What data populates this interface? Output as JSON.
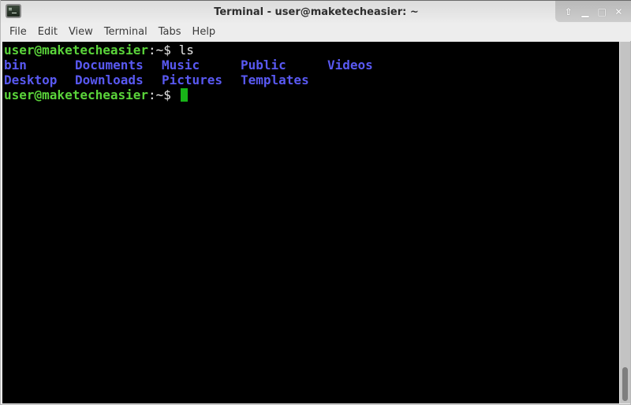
{
  "window": {
    "title": "Terminal - user@maketecheasier: ~",
    "app_icon": "terminal-icon",
    "controls": [
      {
        "name": "keep-above",
        "glyph": "⇧"
      },
      {
        "name": "minimize",
        "glyph": "▁"
      },
      {
        "name": "maximize",
        "glyph": "□"
      },
      {
        "name": "close",
        "glyph": "✕"
      }
    ]
  },
  "menubar": {
    "items": [
      "File",
      "Edit",
      "View",
      "Terminal",
      "Tabs",
      "Help"
    ]
  },
  "terminal": {
    "prompt_user": "user@maketecheasier",
    "prompt_suffix": ":~$ ",
    "command": "ls",
    "listing_row1": [
      "bin",
      "Documents",
      "Music",
      "Public",
      "Videos"
    ],
    "listing_row2": [
      "Desktop",
      "Downloads",
      "Pictures",
      "Templates"
    ],
    "colors": {
      "prompt": "#5ad33a",
      "directory": "#5959f2",
      "text": "#e8e8e8",
      "cursor": "#18b418",
      "background": "#000000"
    }
  }
}
